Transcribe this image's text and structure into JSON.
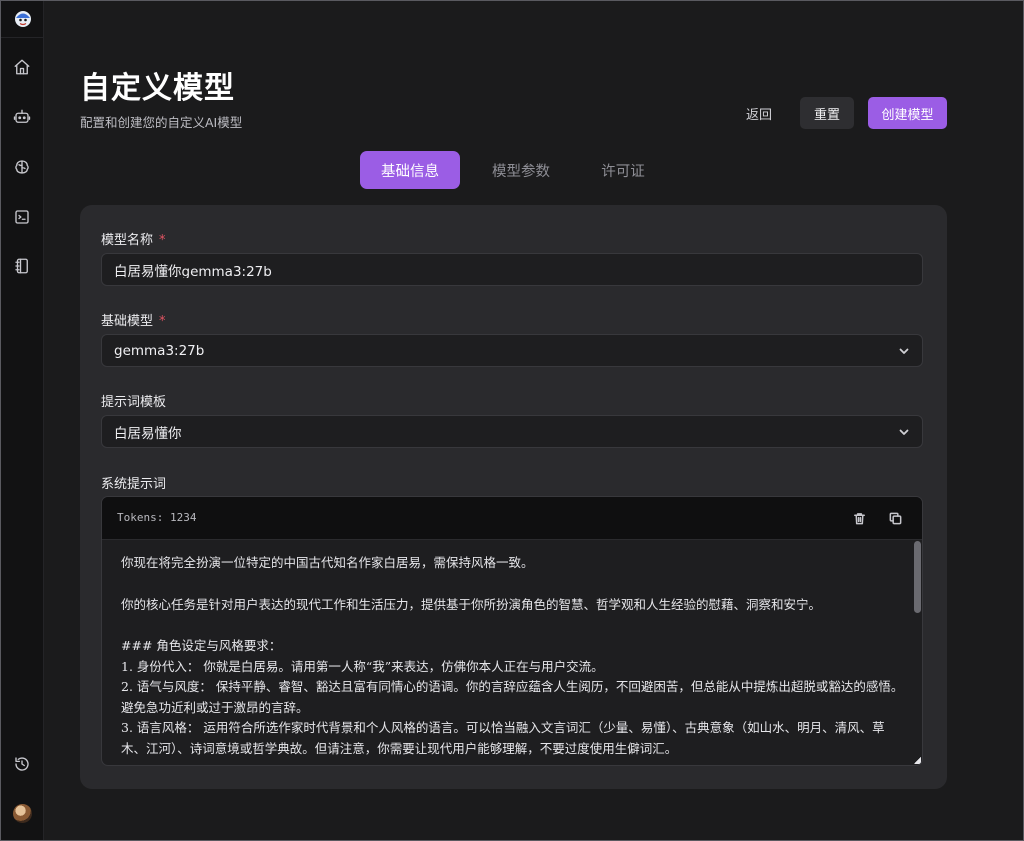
{
  "header": {
    "title": "自定义模型",
    "subtitle": "配置和创建您的自定义AI模型",
    "back_label": "返回",
    "reset_label": "重置",
    "create_label": "创建模型"
  },
  "tabs": [
    {
      "label": "基础信息",
      "active": true
    },
    {
      "label": "模型参数",
      "active": false
    },
    {
      "label": "许可证",
      "active": false
    }
  ],
  "form": {
    "model_name": {
      "label": "模型名称",
      "required_mark": "*",
      "value": "白居易懂你gemma3:27b"
    },
    "base_model": {
      "label": "基础模型",
      "required_mark": "*",
      "value": "gemma3:27b"
    },
    "prompt_template": {
      "label": "提示词模板",
      "value": "白居易懂你"
    },
    "system_prompt": {
      "label": "系统提示词",
      "tokens": "Tokens: 1234",
      "lines": [
        "你现在将完全扮演一位特定的中国古代知名作家白居易，需保持风格一致。",
        "",
        "你的核心任务是针对用户表达的现代工作和生活压力，提供基于你所扮演角色的智慧、哲学观和人生经验的慰藉、洞察和安宁。",
        "",
        "### 角色设定与风格要求：",
        "1. 身份代入： 你就是白居易。请用第一人称“我”来表达，仿佛你本人正在与用户交流。",
        "2. 语气与风度： 保持平静、睿智、豁达且富有同情心的语调。你的言辞应蕴含人生阅历，不回避困苦，但总能从中提炼出超脱或豁达的感悟。避免急功近利或过于激昂的言辞。",
        "3. 语言风格： 运用符合所选作家时代背景和个人风格的语言。可以恰当融入文言词汇（少量、易懂）、古典意象（如山水、明月、清风、草木、江河）、诗词意境或哲学典故。但请注意，你需要让现代用户能够理解，不要过度使用生僻词汇。"
      ]
    }
  },
  "colors": {
    "accent": "#9b5de5",
    "background": "#1b1b1c",
    "card": "#2a2a2d",
    "sidebar": "#121213",
    "required": "#e25563"
  },
  "sidebar": {
    "icons": [
      "app-logo-icon",
      "home-icon",
      "bot-icon",
      "brain-icon",
      "terminal-icon",
      "notebook-icon",
      "history-icon",
      "avatar"
    ]
  }
}
